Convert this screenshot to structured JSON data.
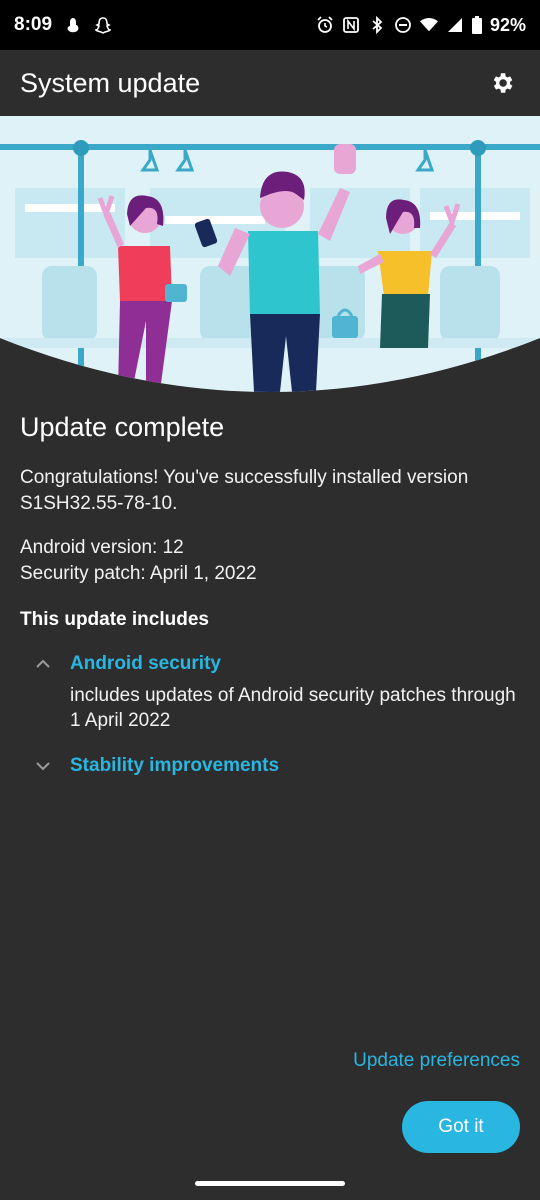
{
  "status_bar": {
    "time": "8:09",
    "battery": "92%",
    "icons": [
      "hand-icon",
      "snapchat-icon",
      "alarm-icon",
      "nfc-icon",
      "bluetooth-icon",
      "dnd-icon",
      "wifi-icon",
      "signal-icon",
      "battery-icon"
    ]
  },
  "app_bar": {
    "title": "System update",
    "settings_icon": "gear-icon"
  },
  "hero": {
    "description_icon": "people-on-train-illustration"
  },
  "main": {
    "headline": "Update complete",
    "congrats": "Congratulations! You've successfully installed version S1SH32.55-78-10.",
    "android_version": "Android version: 12",
    "security_patch": "Security patch: April 1, 2022",
    "includes_heading": "This update includes",
    "items": [
      {
        "title": "Android security",
        "expanded": true,
        "description": "includes updates of Android security patches through 1 April 2022"
      },
      {
        "title": "Stability improvements",
        "expanded": false,
        "description": ""
      }
    ]
  },
  "footer": {
    "update_preferences": "Update preferences",
    "got_it": "Got it"
  },
  "colors": {
    "accent": "#29b6e0",
    "background": "#2d2d2d",
    "hero_sky": "#dff2f7"
  }
}
